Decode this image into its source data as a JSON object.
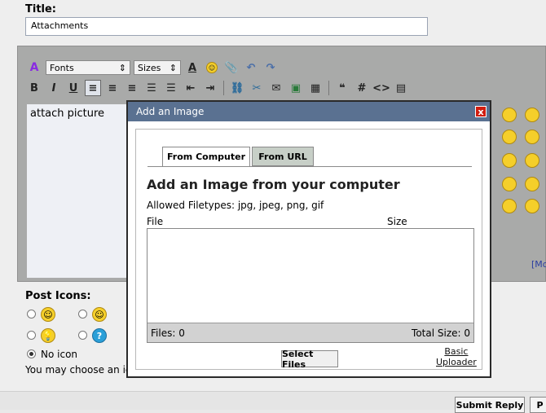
{
  "form": {
    "title_label": "Title:",
    "title_value": "Attachments",
    "editor_text": "attach picture",
    "more_link": "[Mo",
    "post_icons_label": "Post Icons:",
    "no_icon_label": "No icon",
    "choose_text": "You may choose an ic",
    "submit_label": "Submit Reply",
    "second_button_label": "P"
  },
  "toolbar": {
    "fonts_label": "Fonts",
    "sizes_label": "Sizes",
    "bold": "B",
    "italic": "I",
    "underline": "U",
    "hash": "#",
    "code": "<>"
  },
  "dialog": {
    "title": "Add an Image",
    "close": "x",
    "tabs": [
      {
        "label": "From Computer",
        "active": true
      },
      {
        "label": "From URL",
        "active": false
      }
    ],
    "heading": "Add an Image from your computer",
    "filetypes": "Allowed Filetypes: jpg, jpeg, png, gif",
    "col_file": "File",
    "col_size": "Size",
    "files_count": "Files: 0",
    "total_size": "Total Size: 0",
    "select_files": "Select Files",
    "basic_uploader_line1": "Basic",
    "basic_uploader_line2": "Uploader"
  },
  "colors": {
    "dialog_header": "#5a7191",
    "close_button": "#d01d10",
    "editor_bg": "#a9aaa9"
  }
}
